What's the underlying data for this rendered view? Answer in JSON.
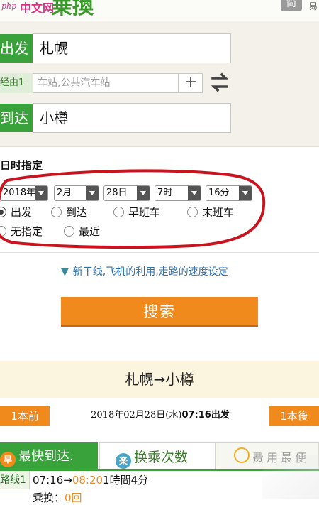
{
  "header": {
    "php_logo": "php",
    "site_name": "中文网",
    "title_fragment": "乗換",
    "header_button": "简",
    "header_right_fragment": "易"
  },
  "form": {
    "departure_label": "出发",
    "departure_value": "札幌",
    "via_label": "经由1",
    "via_placeholder": "车站,公共汽车站",
    "add_via": "+",
    "arrival_label": "到达",
    "arrival_value": "小樽"
  },
  "datetime": {
    "title": "日时指定",
    "year": "2018年",
    "month": "2月",
    "day": "28日",
    "hour": "7时",
    "minute": "16分",
    "options": [
      "出发",
      "到达",
      "早班车",
      "末班车",
      "无指定",
      "最近"
    ],
    "selected": "出发"
  },
  "options_link": "新干线,飞机的利用,走路的速度设定",
  "search_button": "搜索",
  "results": {
    "route": "札幌→小樽",
    "prev": "1本前",
    "next": "1本後",
    "date_prefix": "2018年02月28日(水)",
    "date_time": "07:16",
    "date_suffix": "出发",
    "tabs": {
      "fastest": "最快到达.",
      "fastest_icon": "早",
      "transfers": "换乘次数",
      "transfers_icon": "楽",
      "fare": "费用最便"
    },
    "route_label": "路线1",
    "dep_time": "07:16",
    "arrow": "→",
    "arr_time": "08:20",
    "duration": "1時間4分",
    "transfer_label": "乘换：",
    "transfer_count": "0回"
  },
  "colors": {
    "green": "#3aa23a",
    "orange": "#f08a1c",
    "red_annotation": "#c8141e"
  }
}
